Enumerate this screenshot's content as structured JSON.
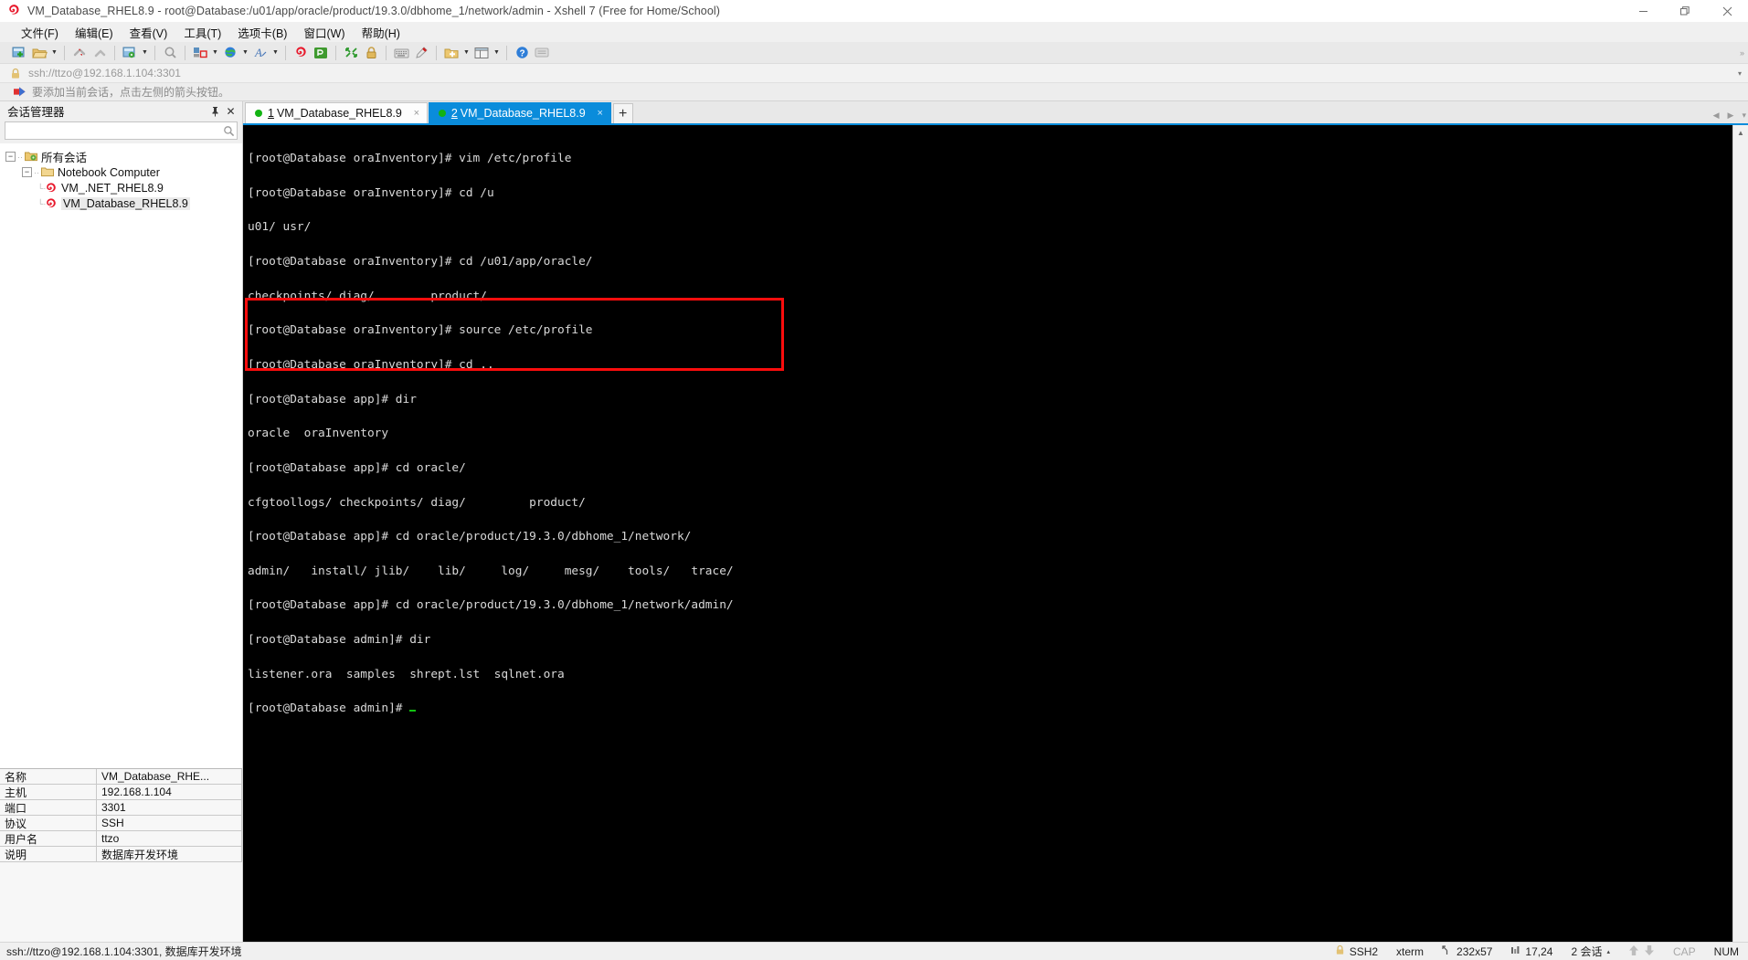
{
  "window": {
    "title": "VM_Database_RHEL8.9 - root@Database:/u01/app/oracle/product/19.3.0/dbhome_1/network/admin - Xshell 7 (Free for Home/School)",
    "minimize_label": "—",
    "maximize_label": "❐",
    "close_label": "✕"
  },
  "menu": {
    "items": [
      {
        "label": "文件(F)",
        "name": "menu-file"
      },
      {
        "label": "编辑(E)",
        "name": "menu-edit"
      },
      {
        "label": "查看(V)",
        "name": "menu-view"
      },
      {
        "label": "工具(T)",
        "name": "menu-tools"
      },
      {
        "label": "选项卡(B)",
        "name": "menu-tabs"
      },
      {
        "label": "窗口(W)",
        "name": "menu-window"
      },
      {
        "label": "帮助(H)",
        "name": "menu-help"
      }
    ]
  },
  "toolbar": {
    "buttons": [
      "new-session-icon",
      "open-folder-icon",
      "dropdown-arrow",
      "sep",
      "disconnect-icon",
      "reconnect-icon",
      "sep",
      "session-properties-icon",
      "dropdown-arrow",
      "sep",
      "find-icon",
      "sep",
      "transfer-file-icon",
      "dropdown-arrow",
      "globe-icon",
      "dropdown-arrow",
      "font-icon",
      "dropdown-arrow",
      "sep",
      "xshell-icon",
      "xftp-icon",
      "sep",
      "fullscreen-icon",
      "lock-icon",
      "sep",
      "keyboard-icon",
      "highlight-icon",
      "sep",
      "add-to-folder-icon",
      "dropdown-arrow",
      "layout-icon",
      "dropdown-arrow",
      "sep",
      "help-icon",
      "comment-icon"
    ],
    "overflow_label": "»"
  },
  "address": {
    "lock_icon": "lock-icon",
    "value": "ssh://ttzo@192.168.1.104:3301",
    "placeholder": "ssh://ttzo@192.168.1.104:3301",
    "dropdown": "▾"
  },
  "hint": {
    "icon": "red-arrow-icon",
    "text": "要添加当前会话，点击左侧的箭头按钮。"
  },
  "sidebar": {
    "title": "会话管理器",
    "pin_label": "丬",
    "close_label": "✕",
    "search": {
      "value": "",
      "placeholder": ""
    },
    "tree": [
      {
        "label": "所有会话",
        "level": 0,
        "expander": "−",
        "icon": "folder-sessions-icon",
        "selected": false,
        "name": "tree-node-all-sessions"
      },
      {
        "label": "Notebook Computer",
        "level": 1,
        "expander": "−",
        "icon": "folder-icon",
        "selected": false,
        "name": "tree-node-notebook-computer"
      },
      {
        "label": "VM_.NET_RHEL8.9",
        "level": 2,
        "expander": "",
        "icon": "xshell-session-icon",
        "selected": false,
        "name": "tree-node-vm-net-rhel89"
      },
      {
        "label": "VM_Database_RHEL8.9",
        "level": 2,
        "expander": "",
        "icon": "xshell-session-icon",
        "selected": true,
        "name": "tree-node-vm-database-rhel89"
      }
    ],
    "properties": [
      {
        "key": "名称",
        "value": "VM_Database_RHE..."
      },
      {
        "key": "主机",
        "value": "192.168.1.104"
      },
      {
        "key": "端口",
        "value": "3301"
      },
      {
        "key": "协议",
        "value": "SSH"
      },
      {
        "key": "用户名",
        "value": "ttzo"
      },
      {
        "key": "说明",
        "value": "数据库开发环境"
      }
    ]
  },
  "tabs": {
    "items": [
      {
        "num": "1",
        "label": "VM_Database_RHEL8.9",
        "active": false,
        "close": "×",
        "name": "tab-1-vm-database-rhel89"
      },
      {
        "num": "2",
        "label": "VM_Database_RHEL8.9",
        "active": true,
        "close": "×",
        "name": "tab-2-vm-database-rhel89"
      }
    ],
    "add_label": "+",
    "nav_left": "◀",
    "nav_right": "▶",
    "nav_menu": "▾"
  },
  "terminal": {
    "lines": [
      "[root@Database oraInventory]# vim /etc/profile",
      "[root@Database oraInventory]# cd /u",
      "u01/ usr/",
      "[root@Database oraInventory]# cd /u01/app/oracle/",
      "checkpoints/ diag/        product/",
      "[root@Database oraInventory]# source /etc/profile",
      "[root@Database oraInventory]# cd ..",
      "[root@Database app]# dir",
      "oracle  oraInventory",
      "[root@Database app]# cd oracle/",
      "cfgtoollogs/ checkpoints/ diag/         product/",
      "[root@Database app]# cd oracle/product/19.3.0/dbhome_1/network/",
      "admin/   install/ jlib/    lib/     log/     mesg/    tools/   trace/",
      "[root@Database app]# cd oracle/product/19.3.0/dbhome_1/network/admin/",
      "[root@Database admin]# dir",
      "listener.ora  samples  shrept.lst  sqlnet.ora"
    ],
    "prompt": "[root@Database admin]# ",
    "cursor": "▁",
    "highlight_color": "#fb0d0d",
    "bg_color": "#000000",
    "fg_color": "#d9d9d9",
    "cursor_color": "#12c212",
    "scroll_up": "▲",
    "scroll_down": "▼"
  },
  "statusbar": {
    "left": "ssh://ttzo@192.168.1.104:3301, 数据库开发环境",
    "protocol": "SSH2",
    "terminal_type": "xterm",
    "size_icon": "resize-icon",
    "size": "232x57",
    "position_icon": "cursor-position-icon",
    "position": "17,24",
    "sessions": "2 会话",
    "sessions_caret": "▴",
    "upload_icon": "arrow-up-icon",
    "download_icon": "arrow-down-icon",
    "cap": "CAP",
    "num": "NUM"
  }
}
